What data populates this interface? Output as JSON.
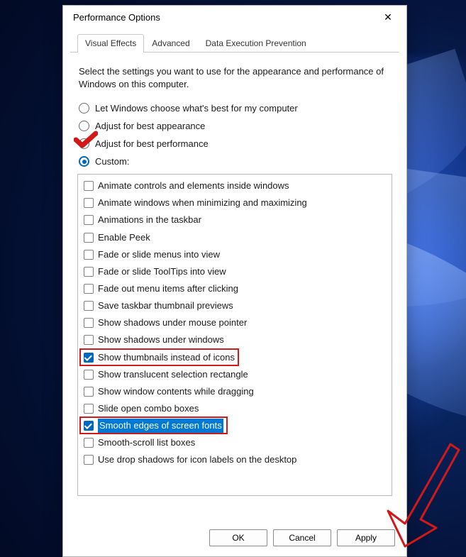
{
  "dialog": {
    "title": "Performance Options",
    "close_icon": "✕"
  },
  "tabs": [
    {
      "label": "Visual Effects",
      "active": true
    },
    {
      "label": "Advanced",
      "active": false
    },
    {
      "label": "Data Execution Prevention",
      "active": false
    }
  ],
  "intro": "Select the settings you want to use for the appearance and performance of Windows on this computer.",
  "radios": [
    {
      "label": "Let Windows choose what's best for my computer",
      "selected": false
    },
    {
      "label": "Adjust for best appearance",
      "selected": false
    },
    {
      "label": "Adjust for best performance",
      "selected": false
    },
    {
      "label": "Custom:",
      "selected": true
    }
  ],
  "options": [
    {
      "label": "Animate controls and elements inside windows",
      "checked": false
    },
    {
      "label": "Animate windows when minimizing and maximizing",
      "checked": false
    },
    {
      "label": "Animations in the taskbar",
      "checked": false
    },
    {
      "label": "Enable Peek",
      "checked": false
    },
    {
      "label": "Fade or slide menus into view",
      "checked": false
    },
    {
      "label": "Fade or slide ToolTips into view",
      "checked": false
    },
    {
      "label": "Fade out menu items after clicking",
      "checked": false
    },
    {
      "label": "Save taskbar thumbnail previews",
      "checked": false
    },
    {
      "label": "Show shadows under mouse pointer",
      "checked": false
    },
    {
      "label": "Show shadows under windows",
      "checked": false
    },
    {
      "label": "Show thumbnails instead of icons",
      "checked": true,
      "redbox": true
    },
    {
      "label": "Show translucent selection rectangle",
      "checked": false
    },
    {
      "label": "Show window contents while dragging",
      "checked": false
    },
    {
      "label": "Slide open combo boxes",
      "checked": false
    },
    {
      "label": "Smooth edges of screen fonts",
      "checked": true,
      "redbox": true,
      "selected": true
    },
    {
      "label": "Smooth-scroll list boxes",
      "checked": false
    },
    {
      "label": "Use drop shadows for icon labels on the desktop",
      "checked": false
    }
  ],
  "buttons": {
    "ok": "OK",
    "cancel": "Cancel",
    "apply": "Apply"
  },
  "annotations": {
    "checkmark_on_radio_index": 2,
    "arrow_points_to": "apply-button"
  }
}
